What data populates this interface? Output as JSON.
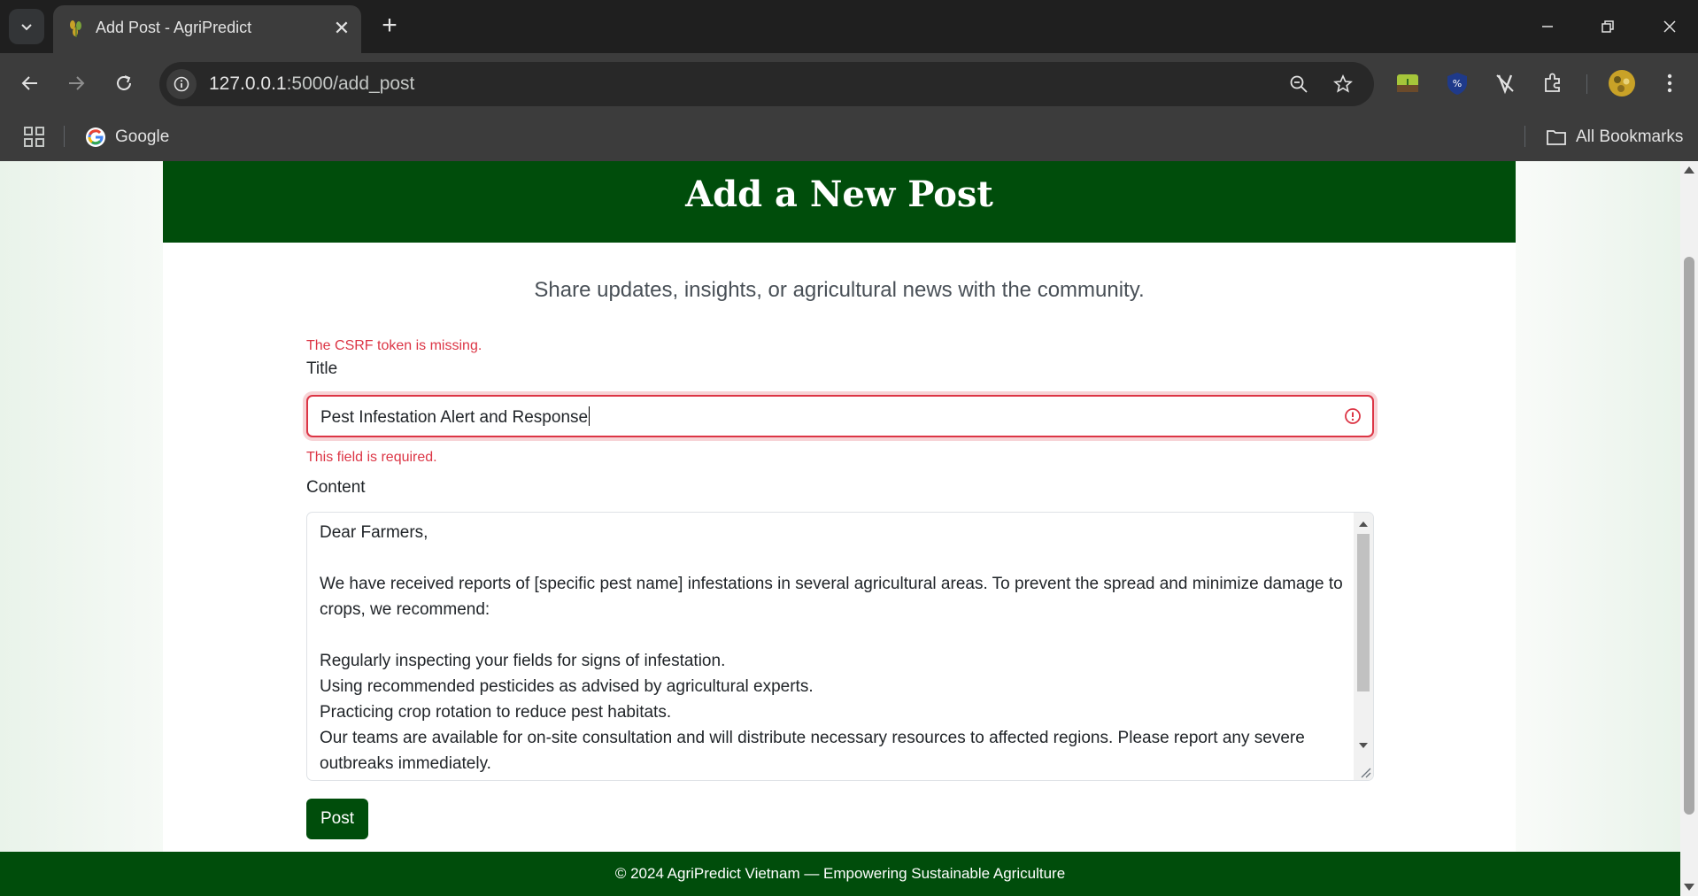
{
  "browser": {
    "tab": {
      "title": "Add Post - AgriPredict",
      "favicon_icon": "wheat-icon",
      "close_glyph": "✕"
    },
    "new_tab_glyph": "+",
    "address": {
      "host": "127.0.0.1",
      "path": ":5000/add_post"
    },
    "bookmarks": {
      "google_label": "Google",
      "all_bookmarks_label": "All Bookmarks"
    }
  },
  "page": {
    "title": "Add a New Post",
    "subtitle": "Share updates, insights, or agricultural news with the community.",
    "form": {
      "csrf_error": "The CSRF token is missing.",
      "title_label": "Title",
      "title_value": "Pest Infestation Alert and Response",
      "title_error": "This field is required.",
      "content_label": "Content",
      "content_value": "Dear Farmers,\n\nWe have received reports of [specific pest name] infestations in several agricultural areas. To prevent the spread and minimize damage to crops, we recommend:\n\nRegularly inspecting your fields for signs of infestation.\nUsing recommended pesticides as advised by agricultural experts.\nPracticing crop rotation to reduce pest habitats.\nOur teams are available for on-site consultation and will distribute necessary resources to affected regions. Please report any severe outbreaks immediately.",
      "submit_label": "Post"
    },
    "footer": "© 2024 AgriPredict Vietnam — Empowering Sustainable Agriculture"
  },
  "colors": {
    "brand_green": "#004d0b",
    "error_red": "#dc3545"
  }
}
